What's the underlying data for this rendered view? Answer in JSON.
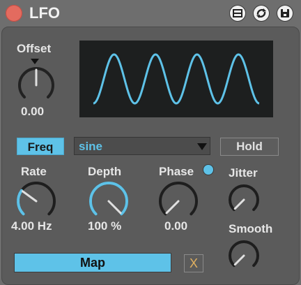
{
  "window": {
    "title": "LFO"
  },
  "titlebar": {
    "icons": [
      "close-dot",
      "map-device-icon",
      "refresh-icon",
      "save-icon"
    ]
  },
  "offset": {
    "label": "Offset",
    "value": "0.00",
    "level": 0.5
  },
  "display": {
    "waveform": "sine",
    "cycles": 4
  },
  "freq_button": {
    "label": "Freq"
  },
  "waveform_select": {
    "value": "sine"
  },
  "hold_button": {
    "label": "Hold"
  },
  "rate": {
    "label": "Rate",
    "value": "4.00 Hz",
    "level": 0.3
  },
  "depth": {
    "label": "Depth",
    "value": "100 %",
    "level": 1.0
  },
  "phase": {
    "label": "Phase",
    "value": "0.00",
    "level": 0.0
  },
  "jitter": {
    "label": "Jitter",
    "level": 0.0
  },
  "smooth": {
    "label": "Smooth",
    "level": 0.0
  },
  "map_button": {
    "label": "Map"
  },
  "clear_button": {
    "label": "X"
  },
  "colors": {
    "accent": "#5ec2e8",
    "panel": "#5b5b5b",
    "display_bg": "#1d1f1f",
    "close": "#e36b5f"
  }
}
